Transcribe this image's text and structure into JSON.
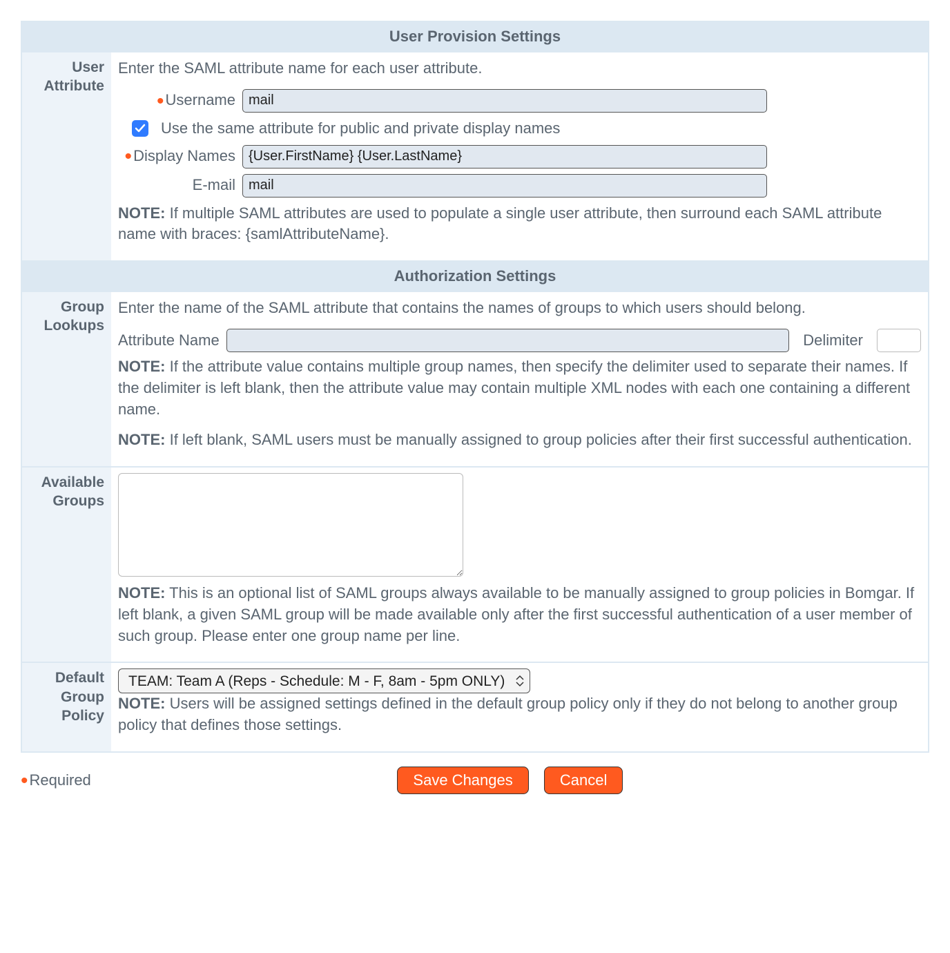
{
  "sections": {
    "user_provision": {
      "title": "User Provision Settings",
      "row_label": "User Attribute",
      "intro": "Enter the SAML attribute name for each user attribute.",
      "fields": {
        "username_label": "Username",
        "username_value": "mail",
        "checkbox_label": "Use the same attribute for public and private display names",
        "display_names_label": "Display Names",
        "display_names_value": "{User.FirstName} {User.LastName}",
        "email_label": "E-mail",
        "email_value": "mail"
      },
      "note_prefix": "NOTE:",
      "note": "If multiple SAML attributes are used to populate a single user attribute, then surround each SAML attribute name with braces: {samlAttributeName}."
    },
    "authorization": {
      "title": "Authorization Settings",
      "group_lookups": {
        "row_label": "Group Lookups",
        "intro": "Enter the name of the SAML attribute that contains the names of groups to which users should belong.",
        "attr_name_label": "Attribute Name",
        "attr_name_value": "",
        "delimiter_label": "Delimiter",
        "delimiter_value": "",
        "note1_prefix": "NOTE:",
        "note1": "If the attribute value contains multiple group names, then specify the delimiter used to separate their names. If the delimiter is left blank, then the attribute value may contain multiple XML nodes with each one containing a different name.",
        "note2_prefix": "NOTE:",
        "note2": "If left blank, SAML users must be manually assigned to group policies after their first successful authentication."
      },
      "available_groups": {
        "row_label": "Available Groups",
        "value": "",
        "note_prefix": "NOTE:",
        "note": "This is an optional list of SAML groups always available to be manually assigned to group policies in Bomgar. If left blank, a given SAML group will be made available only after the first successful authentication of a user member of such group. Please enter one group name per line."
      },
      "default_policy": {
        "row_label": "Default Group Policy",
        "selected": "TEAM: Team A (Reps - Schedule: M - F, 8am - 5pm ONLY)",
        "note_prefix": "NOTE:",
        "note": "Users will be assigned settings defined in the default group policy only if they do not belong to another group policy that defines those settings."
      }
    }
  },
  "footer": {
    "required_label": "Required",
    "save_label": "Save Changes",
    "cancel_label": "Cancel"
  }
}
